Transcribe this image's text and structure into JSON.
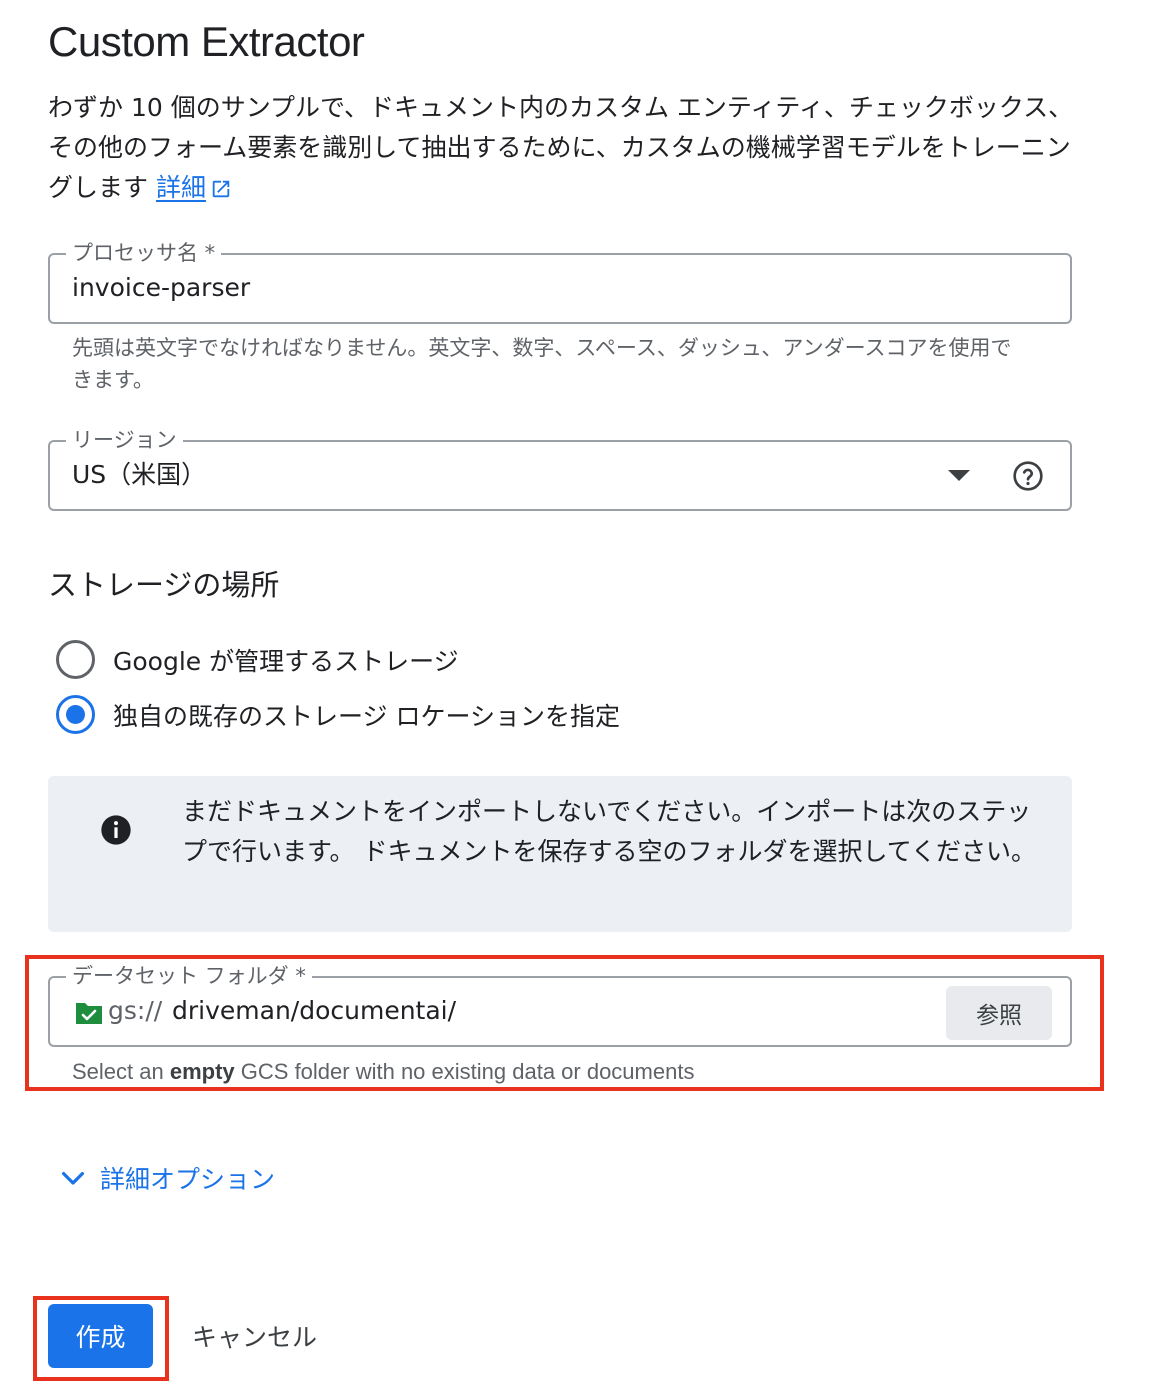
{
  "title": "Custom Extractor",
  "description": {
    "text": "わずか 10 個のサンプルで、ドキュメント内のカスタム エンティティ、チェックボックス、その他のフォーム要素を識別して抽出するために、カスタムの機械学習モデルをトレーニングします",
    "link_label": "詳細",
    "link_icon": "open-in-new-icon"
  },
  "processor_name": {
    "label": "プロセッサ名 *",
    "value": "invoice-parser",
    "hint": "先頭は英文字でなければなりません。英文字、数字、スペース、ダッシュ、アンダースコアを使用できます。"
  },
  "region": {
    "label": "リージョン",
    "value": "US（米国）",
    "icons": [
      "dropdown-arrow-icon",
      "help-icon"
    ]
  },
  "storage": {
    "title": "ストレージの場所",
    "options": [
      {
        "label": "Google が管理するストレージ",
        "checked": false
      },
      {
        "label": "独自の既存のストレージ ロケーションを指定",
        "checked": true
      }
    ]
  },
  "info_box": {
    "icon": "info-icon",
    "text": "まだドキュメントをインポートしないでください。インポートは次のステップで行います。 ドキュメントを保存する空のフォルダを選択してください。"
  },
  "dataset_folder": {
    "label": "データセット フォルダ *",
    "prefix": "gs://",
    "value": "driveman/documentai/",
    "browse_label": "参照",
    "hint_before": "Select an",
    "hint_bold": "empty",
    "hint_after": "GCS folder with no existing data or documents",
    "icon": "folder-check-icon"
  },
  "advanced_options": {
    "label": "詳細オプション",
    "icon": "chevron-down-icon"
  },
  "actions": {
    "create_label": "作成",
    "cancel_label": "キャンセル"
  },
  "colors": {
    "accent": "#1a73e8",
    "highlight": "#e8321e",
    "info_bg": "#eceff3"
  }
}
